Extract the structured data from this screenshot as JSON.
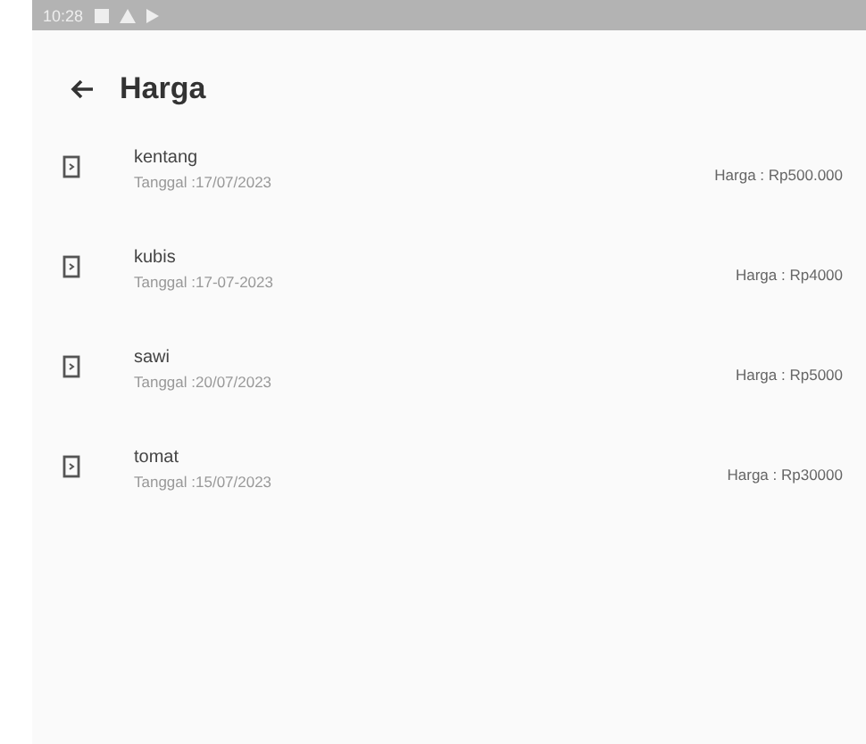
{
  "status_bar": {
    "time": "10:28"
  },
  "app_bar": {
    "title": "Harga"
  },
  "items": [
    {
      "name": "kentang",
      "date": "Tanggal :17/07/2023",
      "price": "Harga : Rp500.000"
    },
    {
      "name": "kubis",
      "date": "Tanggal :17-07-2023",
      "price": "Harga : Rp4000"
    },
    {
      "name": "sawi",
      "date": "Tanggal :20/07/2023",
      "price": "Harga : Rp5000"
    },
    {
      "name": "tomat",
      "date": "Tanggal :15/07/2023",
      "price": "Harga : Rp30000"
    }
  ]
}
